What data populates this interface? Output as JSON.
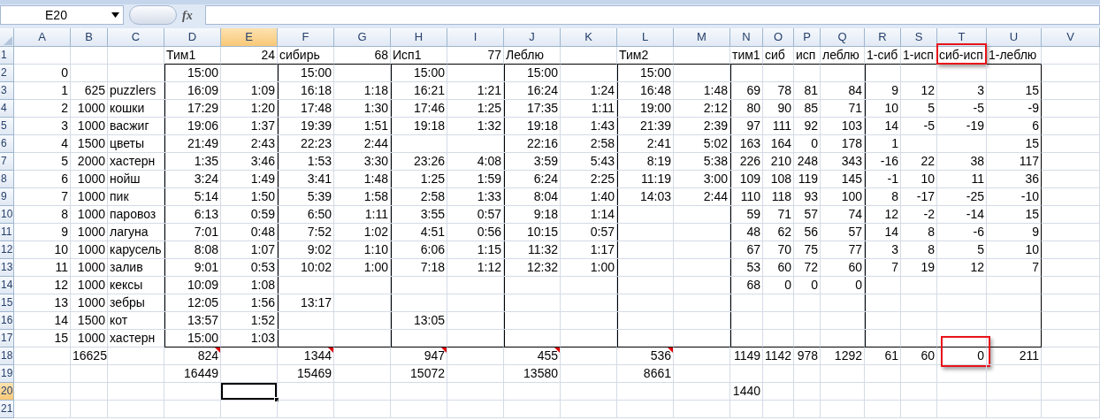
{
  "formula_bar": {
    "name_box": "E20",
    "function_label": "fx"
  },
  "columns": [
    {
      "label": "A",
      "selected": false
    },
    {
      "label": "B",
      "selected": false
    },
    {
      "label": "C",
      "selected": false
    },
    {
      "label": "D",
      "selected": false
    },
    {
      "label": "E",
      "selected": true
    },
    {
      "label": "F",
      "selected": false
    },
    {
      "label": "G",
      "selected": false
    },
    {
      "label": "H",
      "selected": false
    },
    {
      "label": "I",
      "selected": false
    },
    {
      "label": "J",
      "selected": false
    },
    {
      "label": "K",
      "selected": false
    },
    {
      "label": "L",
      "selected": false
    },
    {
      "label": "M",
      "selected": false
    },
    {
      "label": "N",
      "selected": false
    },
    {
      "label": "O",
      "selected": false
    },
    {
      "label": "P",
      "selected": false
    },
    {
      "label": "Q",
      "selected": false
    },
    {
      "label": "R",
      "selected": false
    },
    {
      "label": "S",
      "selected": false
    },
    {
      "label": "T",
      "selected": false
    },
    {
      "label": "U",
      "selected": false
    },
    {
      "label": "V",
      "selected": false
    }
  ],
  "rows": [
    {
      "label": "1",
      "selected": false,
      "cells": [
        null,
        null,
        null,
        {
          "text": "Тим1",
          "kind": "label"
        },
        "24",
        {
          "text": "сибирь",
          "kind": "label"
        },
        "68",
        {
          "text": "Исп1",
          "kind": "label"
        },
        "77",
        {
          "text": "Леблю",
          "kind": "label"
        },
        null,
        {
          "text": "Тим2",
          "kind": "label"
        },
        null,
        {
          "text": "тим1",
          "kind": "label"
        },
        {
          "text": "сиб",
          "kind": "label"
        },
        {
          "text": "исп",
          "kind": "label"
        },
        {
          "text": "леблю",
          "kind": "label"
        },
        {
          "text": "1-сиб",
          "kind": "label"
        },
        {
          "text": "1-исп",
          "kind": "label"
        },
        {
          "text": "сиб-исп",
          "kind": "label",
          "highlighted": true
        },
        {
          "text": "1-леблю",
          "kind": "label"
        }
      ]
    },
    {
      "label": "2",
      "selected": false,
      "cells": [
        "0",
        null,
        null,
        "15:00",
        null,
        "15:00",
        null,
        "15:00",
        null,
        "15:00",
        null,
        "15:00"
      ]
    },
    {
      "label": "3",
      "selected": false,
      "cells": [
        "1",
        "625",
        {
          "text": "puzzlers",
          "kind": "label"
        },
        "16:09",
        "1:09",
        "16:18",
        "1:18",
        "16:21",
        "1:21",
        "16:24",
        "1:24",
        "16:48",
        "1:48",
        "69",
        "78",
        "81",
        "84",
        "9",
        "12",
        "3",
        "15"
      ]
    },
    {
      "label": "4",
      "selected": false,
      "cells": [
        "2",
        "1000",
        {
          "text": "кошки",
          "kind": "label"
        },
        "17:29",
        "1:20",
        "17:48",
        "1:30",
        "17:46",
        "1:25",
        "17:35",
        "1:11",
        "19:00",
        "2:12",
        "80",
        "90",
        "85",
        "71",
        "10",
        "5",
        "-5",
        "-9"
      ]
    },
    {
      "label": "5",
      "selected": false,
      "cells": [
        "3",
        "1000",
        {
          "text": "васжиг",
          "kind": "label"
        },
        "19:06",
        "1:37",
        "19:39",
        "1:51",
        "19:18",
        "1:32",
        "19:18",
        "1:43",
        "21:39",
        "2:39",
        "97",
        "111",
        "92",
        "103",
        "14",
        "-5",
        "-19",
        "6"
      ]
    },
    {
      "label": "6",
      "selected": false,
      "cells": [
        "4",
        "1500",
        {
          "text": "цветы",
          "kind": "label"
        },
        "21:49",
        "2:43",
        "22:23",
        "2:44",
        null,
        null,
        "22:16",
        "2:58",
        "2:41",
        "5:02",
        "163",
        "164",
        "0",
        "178",
        "1",
        null,
        null,
        "15"
      ]
    },
    {
      "label": "7",
      "selected": false,
      "cells": [
        "5",
        "2000",
        {
          "text": "хастерн",
          "kind": "label"
        },
        "1:35",
        "3:46",
        "1:53",
        "3:30",
        "23:26",
        "4:08",
        "3:59",
        "5:43",
        "8:19",
        "5:38",
        "226",
        "210",
        "248",
        "343",
        "-16",
        "22",
        "38",
        "117"
      ]
    },
    {
      "label": "8",
      "selected": false,
      "cells": [
        "6",
        "1000",
        {
          "text": "нойш",
          "kind": "label"
        },
        "3:24",
        "1:49",
        "3:41",
        "1:48",
        "1:25",
        "1:59",
        "6:24",
        "2:25",
        "11:19",
        "3:00",
        "109",
        "108",
        "119",
        "145",
        "-1",
        "10",
        "11",
        "36"
      ]
    },
    {
      "label": "9",
      "selected": false,
      "cells": [
        "7",
        "1000",
        {
          "text": "пик",
          "kind": "label"
        },
        "5:14",
        "1:50",
        "5:39",
        "1:58",
        "2:58",
        "1:33",
        "8:04",
        "1:40",
        "14:03",
        "2:44",
        "110",
        "118",
        "93",
        "100",
        "8",
        "-17",
        "-25",
        "-10"
      ]
    },
    {
      "label": "10",
      "selected": false,
      "cells": [
        "8",
        "1000",
        {
          "text": "паровоз",
          "kind": "label"
        },
        "6:13",
        "0:59",
        "6:50",
        "1:11",
        "3:55",
        "0:57",
        "9:18",
        "1:14",
        null,
        null,
        "59",
        "71",
        "57",
        "74",
        "12",
        "-2",
        "-14",
        "15"
      ]
    },
    {
      "label": "11",
      "selected": false,
      "cells": [
        "9",
        "1000",
        {
          "text": "лагуна",
          "kind": "label"
        },
        "7:01",
        "0:48",
        "7:52",
        "1:02",
        "4:51",
        "0:56",
        "10:15",
        "0:57",
        null,
        null,
        "48",
        "62",
        "56",
        "57",
        "14",
        "8",
        "-6",
        "9"
      ]
    },
    {
      "label": "12",
      "selected": false,
      "cells": [
        "10",
        "1000",
        {
          "text": "карусель",
          "kind": "label"
        },
        "8:08",
        "1:07",
        "9:02",
        "1:10",
        "6:06",
        "1:15",
        "11:32",
        "1:17",
        null,
        null,
        "67",
        "70",
        "75",
        "77",
        "3",
        "8",
        "5",
        "10"
      ]
    },
    {
      "label": "13",
      "selected": false,
      "cells": [
        "11",
        "1000",
        {
          "text": "залив",
          "kind": "label"
        },
        "9:01",
        "0:53",
        "10:02",
        "1:00",
        "7:18",
        "1:12",
        "12:32",
        "1:00",
        null,
        null,
        "53",
        "60",
        "72",
        "60",
        "7",
        "19",
        "12",
        "7"
      ]
    },
    {
      "label": "14",
      "selected": false,
      "cells": [
        "12",
        "1000",
        {
          "text": "кексы",
          "kind": "label"
        },
        "10:09",
        "1:08",
        null,
        null,
        null,
        null,
        null,
        null,
        null,
        null,
        "68",
        "0",
        "0",
        "0"
      ]
    },
    {
      "label": "15",
      "selected": false,
      "cells": [
        "13",
        "1000",
        {
          "text": "зебры",
          "kind": "label"
        },
        "12:05",
        "1:56",
        "13:17"
      ]
    },
    {
      "label": "16",
      "selected": false,
      "cells": [
        "14",
        "1500",
        {
          "text": "кот",
          "kind": "label"
        },
        "13:57",
        "1:52",
        null,
        null,
        "13:05"
      ]
    },
    {
      "label": "17",
      "selected": false,
      "cells": [
        "15",
        "1000",
        {
          "text": "хастерн",
          "kind": "label"
        },
        "15:00",
        "1:03"
      ]
    },
    {
      "label": "18",
      "selected": false,
      "cells": [
        null,
        "16625",
        null,
        {
          "text": "824",
          "kind": "number",
          "comment": true
        },
        null,
        {
          "text": "1344",
          "kind": "number",
          "comment": true
        },
        null,
        {
          "text": "947",
          "kind": "number",
          "comment": true
        },
        null,
        {
          "text": "455",
          "kind": "number",
          "comment": true
        },
        null,
        {
          "text": "536",
          "kind": "number",
          "comment": true
        },
        null,
        "1149",
        "1142",
        "978",
        "1292",
        "61",
        "60",
        {
          "text": "0",
          "kind": "number",
          "highlighted": true
        },
        "211"
      ]
    },
    {
      "label": "19",
      "selected": false,
      "cells": [
        null,
        null,
        null,
        "16449",
        null,
        "15469",
        null,
        "15072",
        null,
        "13580",
        null,
        "8661"
      ]
    },
    {
      "label": "20",
      "selected": true,
      "cells": [
        null,
        null,
        null,
        null,
        {
          "selected": true
        },
        null,
        null,
        null,
        null,
        null,
        null,
        null,
        null,
        "1440"
      ]
    },
    {
      "label": "21",
      "selected": false,
      "cells": []
    }
  ]
}
